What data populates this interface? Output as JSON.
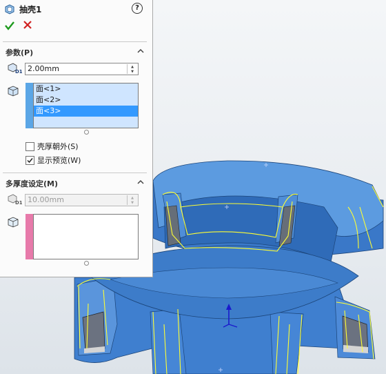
{
  "panel": {
    "title": "抽壳1",
    "help_icon": "?",
    "ok_icon": "check-icon",
    "cancel_icon": "x-icon",
    "params": {
      "header": "参数(P)",
      "thickness_value": "2.00mm",
      "faces": [
        "面<1>",
        "面<2>",
        "面<3>"
      ],
      "selected_face_index": 2,
      "shell_outward_label": "壳厚朝外(S)",
      "shell_outward_checked": false,
      "show_preview_label": "显示预览(W)",
      "show_preview_checked": true
    },
    "multi": {
      "header": "多厚度设定(M)",
      "thickness_value": "10.00mm"
    }
  },
  "colors": {
    "ok": "#1d9a1d",
    "cancel": "#d02020",
    "selection": "#3399ff",
    "list_bg": "#cfe5ff",
    "list_strip": "#5ba6e6",
    "multi_strip": "#e77aaa",
    "part_blue": "#3f82d6",
    "edge_yellow": "#ffff33"
  }
}
